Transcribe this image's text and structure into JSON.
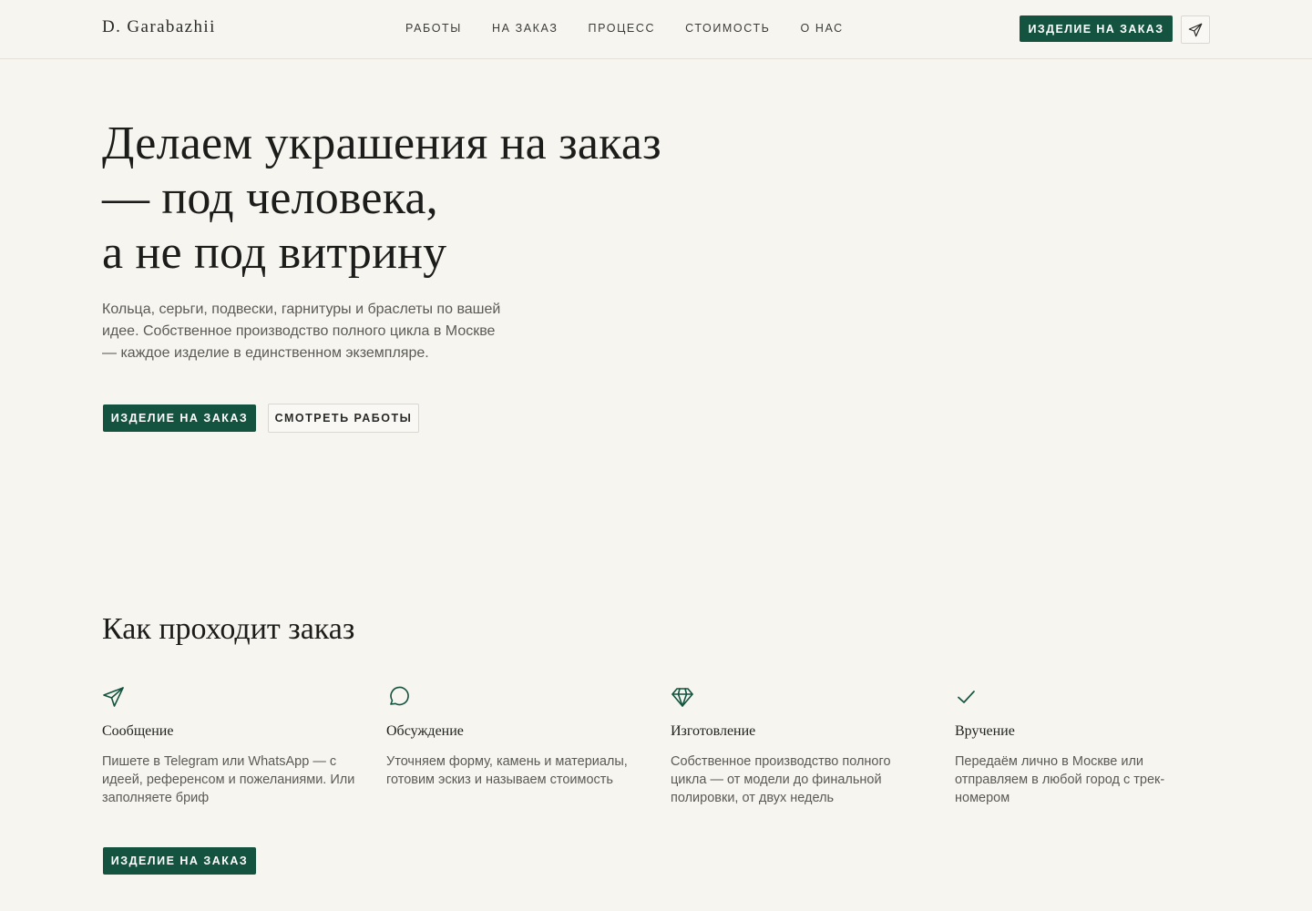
{
  "header": {
    "logo": "D. Garabazhii",
    "nav": [
      {
        "label": "РАБОТЫ"
      },
      {
        "label": "НА ЗАКАЗ"
      },
      {
        "label": "ПРОЦЕСС"
      },
      {
        "label": "СТОИМОСТЬ"
      },
      {
        "label": "О НАС"
      }
    ],
    "cta_label": "ИЗДЕЛИЕ НА ЗАКАЗ",
    "telegram_icon": "telegram-icon"
  },
  "hero": {
    "title_lines": [
      "Делаем украшения на заказ",
      "— под человека,",
      "а не под витрину"
    ],
    "text": "Кольца, серьги, подвески, гарнитуры и браслеты по вашей идее. Собственное производство полного цикла в Москве — каждое изделие в единственном экземпляре.",
    "primary_button": "ИЗДЕЛИЕ НА ЗАКАЗ",
    "secondary_button": "СМОТРЕТЬ РАБОТЫ"
  },
  "process": {
    "title": "Как проходит заказ",
    "steps": [
      {
        "icon": "send-icon",
        "title": "Сообщение",
        "text": "Пишете в Telegram или WhatsApp — с идеей, референсом и пожеланиями. Или заполняете бриф"
      },
      {
        "icon": "chat-bubble-icon",
        "title": "Обсуждение",
        "text": "Уточняем форму, камень и материалы, готовим эскиз и называем стоимость"
      },
      {
        "icon": "diamond-icon",
        "title": "Изготовление",
        "text": "Собственное производство полного цикла — от модели до финальной полировки, от двух недель"
      },
      {
        "icon": "check-icon",
        "title": "Вручение",
        "text": "Передаём лично в Москве или отправляем в любой город с трек-номером"
      }
    ],
    "button": "ИЗДЕЛИЕ НА ЗАКАЗ"
  },
  "colors": {
    "background": "#f6f5f0",
    "accent": "#13533f",
    "text": "#1d1d1b",
    "muted": "#5b5a55"
  }
}
